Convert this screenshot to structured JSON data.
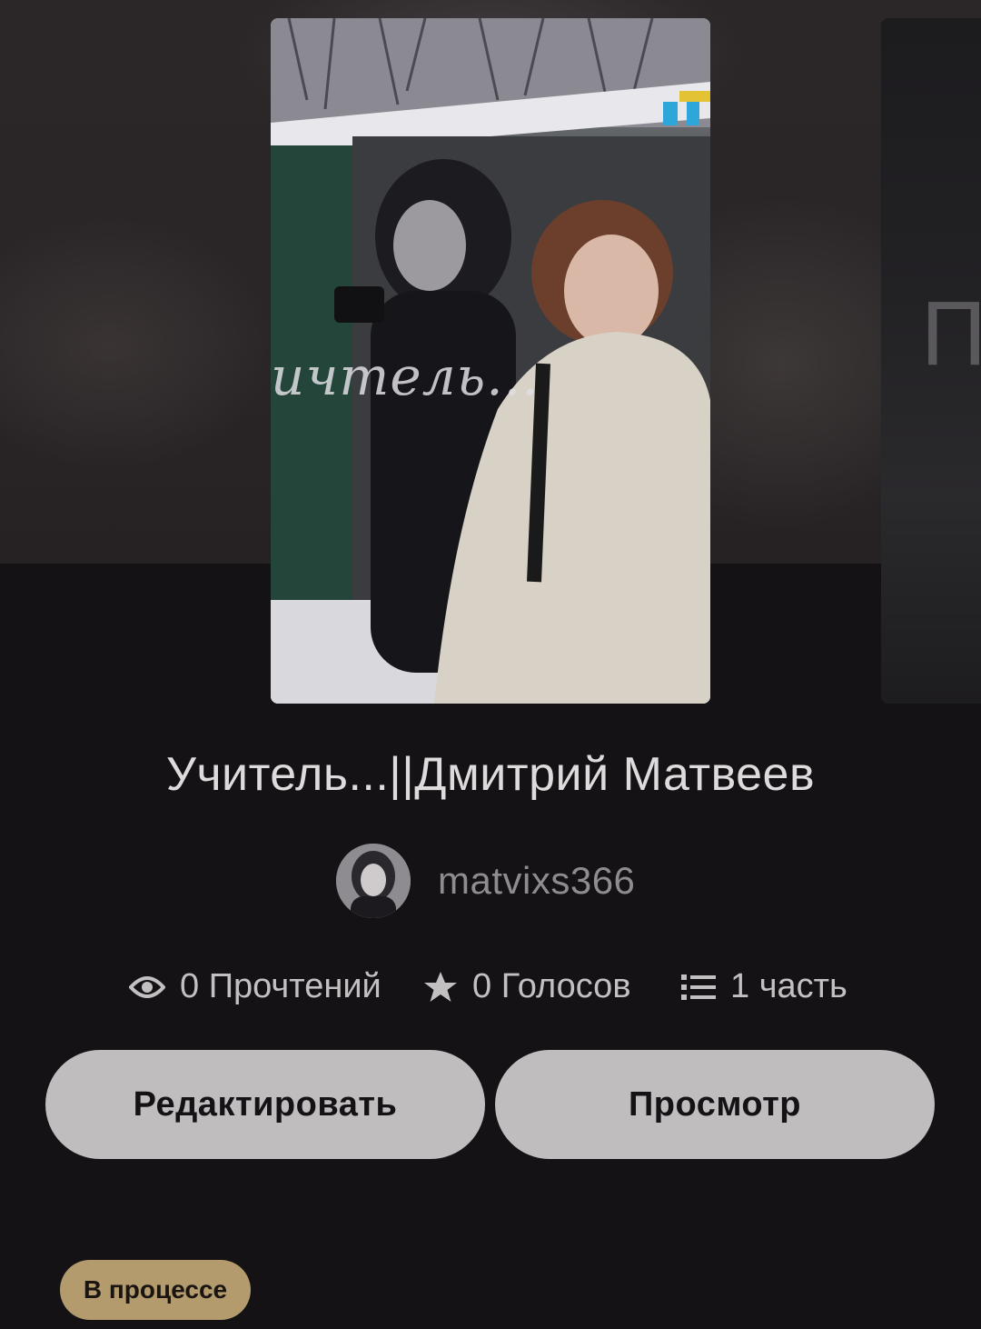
{
  "story": {
    "title": "Учитель...||Дмитрий Матвеев",
    "cover_text": "ичтель...",
    "author": "matvixs366",
    "next_card_text": "ПА"
  },
  "stats": {
    "reads": "0 Прочтений",
    "votes": "0 Голосов",
    "parts": "1 часть"
  },
  "actions": {
    "edit_label": "Редактировать",
    "view_label": "Просмотр"
  },
  "status": {
    "label": "В процессе",
    "color": "#b39b6d"
  },
  "icons": {
    "reads": "eye-icon",
    "votes": "star-icon",
    "parts": "list-icon"
  }
}
